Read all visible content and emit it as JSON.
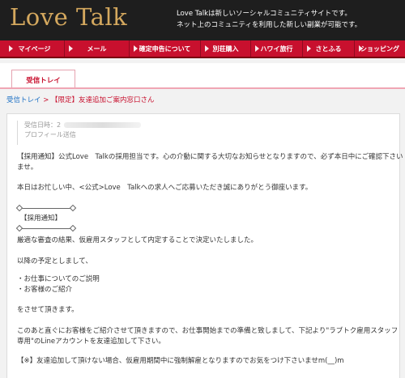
{
  "header": {
    "logo": "Love Talk",
    "tagline_1": "Love Talkは新しいソーシャルコミュニティサイトです。",
    "tagline_2": "ネット上のコミュニティを利用した新しい副業が可能です。"
  },
  "nav": {
    "items": [
      {
        "label": "マイページ"
      },
      {
        "label": "メール"
      },
      {
        "label": "確定申告について"
      },
      {
        "label": "別荘購入"
      },
      {
        "label": "ハワイ旅行"
      },
      {
        "label": "さとふる"
      },
      {
        "label": "ショッピング"
      }
    ]
  },
  "tabs": {
    "inbox": "受信トレイ"
  },
  "breadcrumb": {
    "inbox": "受信トレイ",
    "separator": ">",
    "current": "【限定】友達追加ご案内窓口さん"
  },
  "message": {
    "received_label": "受信日時：",
    "received_value": "2",
    "profile_label": "プロフィール送信",
    "lines": {
      "l1": "【採用通知】公式Love　Talkの採用担当です。心の介動に関する大切なお知らせとなりますので、必ず本日中にご確認下さい",
      "l2": "ませ。",
      "l3": "本日はお忙しい中、<公式>Love　Talkへの求人へご応募いただき誠にありがとう御座います。",
      "l4": "【採用通知】",
      "l5": "厳適な審査の結果、仮雇用スタッフとして内定することで決定いたしました。",
      "l6": "以降の予定としまして、",
      "l7": "・お仕事についてのご説明",
      "l8": "・お客様のご紹介",
      "l9": "をさせて頂きます。",
      "l10": "このあと直ぐにお客様をご紹介させて頂きますので、お仕事開始までの準備と致しまして、下記より\"ラブトク雇用スタッフ",
      "l11": "専用\"のLineアカウントを友達追加して下さい。",
      "l12": "【※】友達追加して頂けない場合、仮雇用期間中に強制解雇となりますのでお気をつけ下さいませm(__)m"
    }
  }
}
